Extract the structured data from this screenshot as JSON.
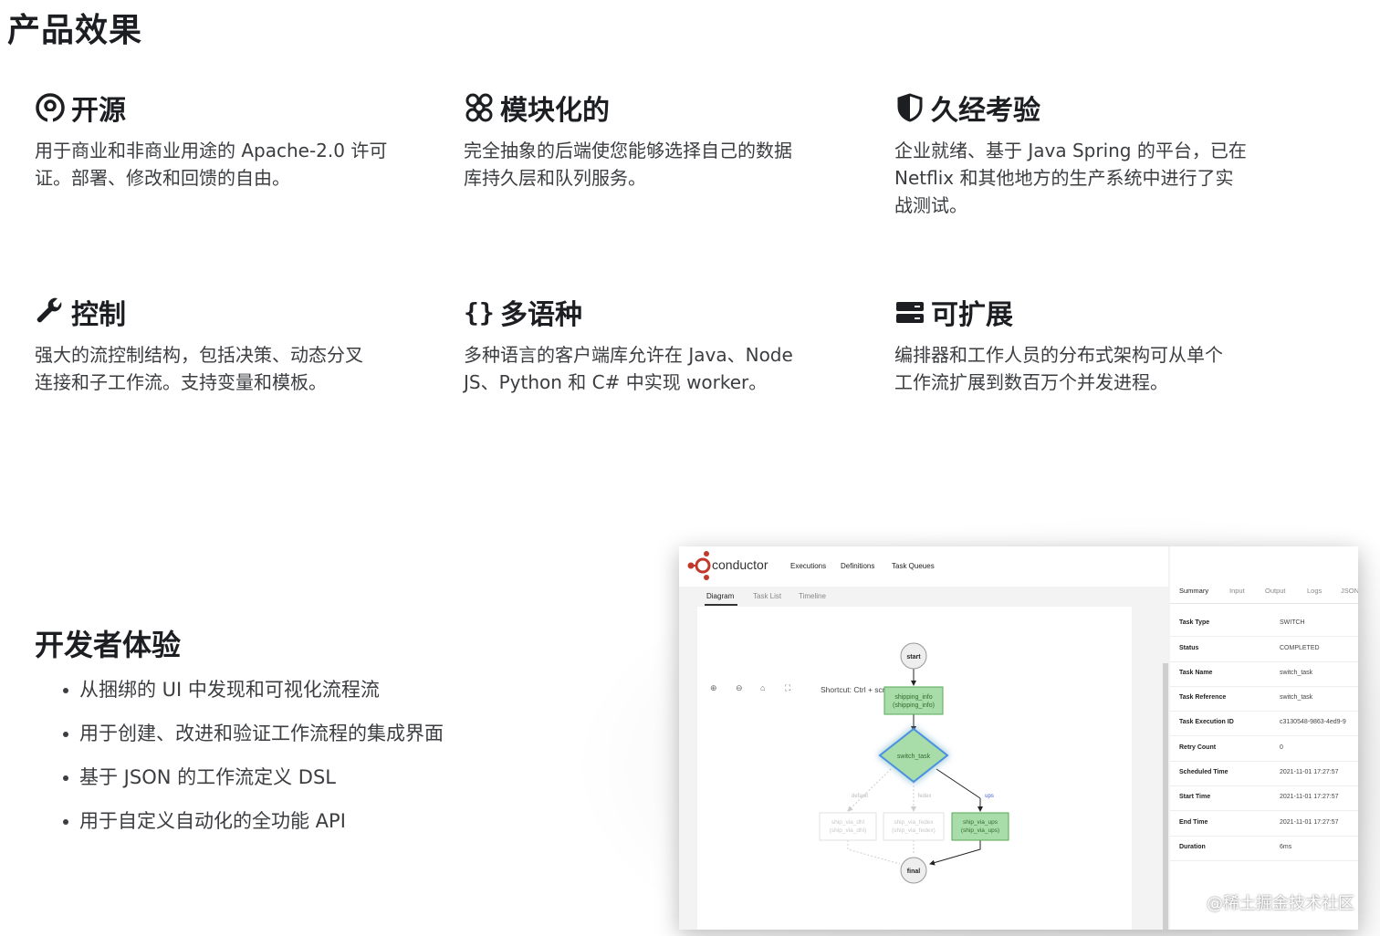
{
  "page_title": "产品效果",
  "features": [
    {
      "icon": "open-source-icon",
      "title": "开源",
      "lines": [
        "用于商业和非商业用途的 Apache-2.0 许可",
        "证。部署、修改和回馈的自由。"
      ]
    },
    {
      "icon": "modular-icon",
      "title": "模块化的",
      "lines": [
        "完全抽象的后端使您能够选择自己的数据",
        "库持久层和队列服务。"
      ]
    },
    {
      "icon": "shield-icon",
      "title": "久经考验",
      "lines": [
        "企业就绪、基于 Java Spring 的平台，已在",
        "Netflix 和其他地方的生产系统中进行了实",
        "战测试。"
      ]
    },
    {
      "icon": "wrench-icon",
      "title": "控制",
      "lines": [
        "强大的流控制结构，包括决策、动态分叉",
        "连接和子工作流。支持变量和模板。"
      ]
    },
    {
      "icon": "braces-icon",
      "title": "多语种",
      "lines": [
        "多种语言的客户端库允许在 Java、Node",
        "JS、Python 和 C# 中实现 worker。"
      ]
    },
    {
      "icon": "server-icon",
      "title": "可扩展",
      "lines": [
        "编排器和工作人员的分布式架构可从单个",
        "工作流扩展到数百万个并发进程。"
      ]
    }
  ],
  "dev": {
    "title": "开发者体验",
    "items": [
      "从捆绑的 UI 中发现和可视化流程流",
      "用于创建、改进和验证工作流程的集成界面",
      "基于 JSON 的工作流定义 DSL",
      "用于自定义自动化的全功能 API"
    ]
  },
  "app": {
    "logo": "conductor",
    "nav": [
      "Executions",
      "Definitions",
      "Task Queues"
    ],
    "subtabs": [
      "Diagram",
      "Task List",
      "Timeline"
    ],
    "shortcut": "Shortcut: Ctrl + scroll to zoom",
    "nodes": {
      "start": "start",
      "shipping_1": "shipping_info",
      "shipping_2": "(shipping_info)",
      "switch": "switch_task",
      "default_label": "default",
      "fedex_label": "fedex",
      "ups_label": "ups",
      "dhl_1": "ship_via_dhl",
      "dhl_2": "(ship_via_dhl)",
      "fedex_1": "ship_via_fedex",
      "fedex_2": "(ship_via_fedex)",
      "ups_1": "ship_via_ups",
      "ups_2": "(ship_via_ups)",
      "final": "final"
    },
    "right_tabs": [
      "Summary",
      "Input",
      "Output",
      "Logs",
      "JSON"
    ],
    "details": [
      {
        "key": "Task Type",
        "value": "SWITCH"
      },
      {
        "key": "Status",
        "value": "COMPLETED"
      },
      {
        "key": "Task Name",
        "value": "switch_task"
      },
      {
        "key": "Task Reference",
        "value": "switch_task"
      },
      {
        "key": "Task Execution ID",
        "value": "c3130548-9863-4ed9-9"
      },
      {
        "key": "Retry Count",
        "value": "0"
      },
      {
        "key": "Scheduled Time",
        "value": "2021-11-01 17:27:57"
      },
      {
        "key": "Start Time",
        "value": "2021-11-01 17:27:57"
      },
      {
        "key": "End Time",
        "value": "2021-11-01 17:27:57"
      },
      {
        "key": "Duration",
        "value": "6ms"
      }
    ]
  },
  "watermark": "@稀土掘金技术社区",
  "colors": {
    "text": "#1c1e21",
    "node_green": "#a8dca8",
    "node_border": "#5aa85a",
    "accent": "#c0392b"
  }
}
